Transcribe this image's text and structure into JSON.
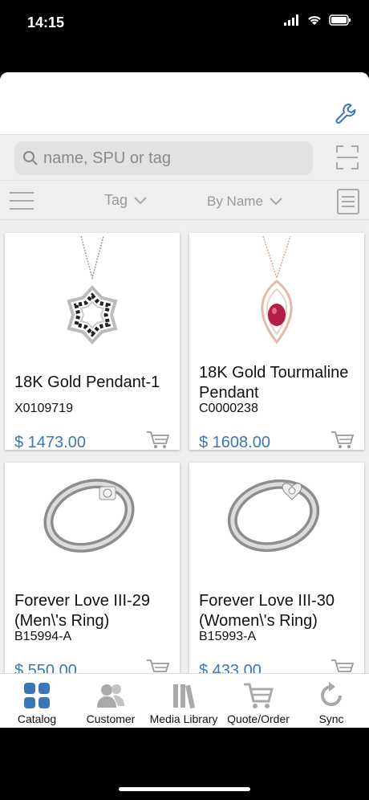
{
  "status_bar": {
    "time": "14:15"
  },
  "search": {
    "placeholder": "name, SPU or tag"
  },
  "filters": {
    "tag_label": "Tag",
    "sort_label": "By Name"
  },
  "products": [
    {
      "title": "18K Gold Pendant-1",
      "code": "X0109719",
      "price": "$ 1473.00"
    },
    {
      "title": "18K Gold Tourmaline Pendant",
      "code": "C0000238",
      "price": "$ 1608.00"
    },
    {
      "title": "Forever Love III-29 (Men\\'s Ring)",
      "code": "B15994-A",
      "price": "$ 550.00"
    },
    {
      "title": "Forever Love III-30 (Women\\'s Ring)",
      "code": "B15993-A",
      "price": "$ 433.00"
    }
  ],
  "tabs": [
    {
      "label": "Catalog",
      "icon": "catalog-grid-icon",
      "active": true
    },
    {
      "label": "Customer",
      "icon": "customer-icon"
    },
    {
      "label": "Media Library",
      "icon": "media-library-icon"
    },
    {
      "label": "Quote/Order",
      "icon": "cart-icon"
    },
    {
      "label": "Sync",
      "icon": "sync-icon"
    }
  ],
  "colors": {
    "accent": "#3a78b5",
    "icon_gray": "#a9a9a9"
  }
}
